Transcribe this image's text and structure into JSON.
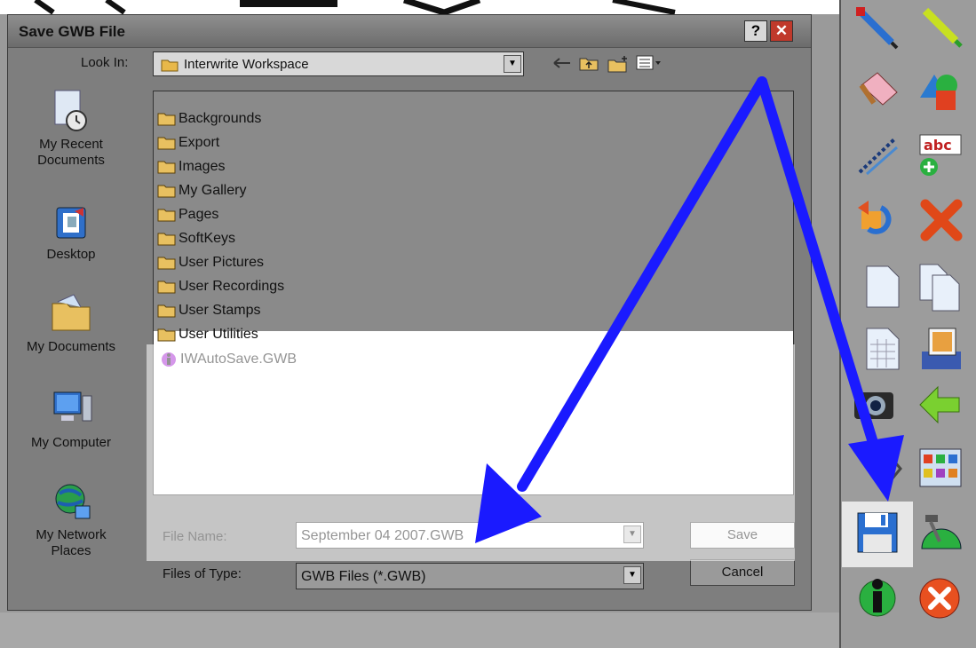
{
  "dialog": {
    "title": "Save GWB File",
    "help_label": "?",
    "close_label": "✕",
    "look_in_label": "Look In:",
    "look_in_value": "Interwrite Workspace",
    "toolbar": [
      "back-icon",
      "up-folder-icon",
      "new-folder-icon",
      "view-menu-icon"
    ]
  },
  "places": [
    {
      "label": "My Recent\nDocuments",
      "icon": "recent-documents-icon"
    },
    {
      "label": "Desktop",
      "icon": "desktop-icon"
    },
    {
      "label": "My Documents",
      "icon": "my-documents-icon"
    },
    {
      "label": "My Computer",
      "icon": "my-computer-icon"
    },
    {
      "label": "My Network\nPlaces",
      "icon": "network-places-icon"
    }
  ],
  "files": [
    {
      "name": "Backgrounds",
      "type": "folder"
    },
    {
      "name": "Export",
      "type": "folder"
    },
    {
      "name": "Images",
      "type": "folder"
    },
    {
      "name": "My Gallery",
      "type": "folder"
    },
    {
      "name": "Pages",
      "type": "folder"
    },
    {
      "name": "SoftKeys",
      "type": "folder"
    },
    {
      "name": "User Pictures",
      "type": "folder"
    },
    {
      "name": "User Recordings",
      "type": "folder"
    },
    {
      "name": "User Stamps",
      "type": "folder"
    },
    {
      "name": "User Utilities",
      "type": "folder"
    },
    {
      "name": "IWAutoSave.GWB",
      "type": "gwb"
    }
  ],
  "form": {
    "file_name_label": "File Name:",
    "file_name_value": "September 04 2007.GWB",
    "file_type_label": "Files of Type:",
    "file_type_value": "GWB Files (*.GWB)",
    "save_label": "Save",
    "cancel_label": "Cancel"
  },
  "right_toolbar": [
    "pen-icon",
    "highlighter-icon",
    "eraser-icon",
    "shapes-icon",
    "line-tool-icon",
    "text-tool-icon",
    "undo-icon",
    "delete-icon",
    "new-page-icon",
    "copy-page-icon",
    "grid-page-icon",
    "insert-image-icon",
    "camera-icon",
    "back-arrow-icon",
    "toolbar-overflow-icon",
    "gallery-icon",
    "save-icon",
    "tools-icon",
    "info-icon",
    "exit-icon"
  ],
  "colors": {
    "arrow": "#1a1aff",
    "close": "#c0392b",
    "folder": "#e8b84a"
  }
}
